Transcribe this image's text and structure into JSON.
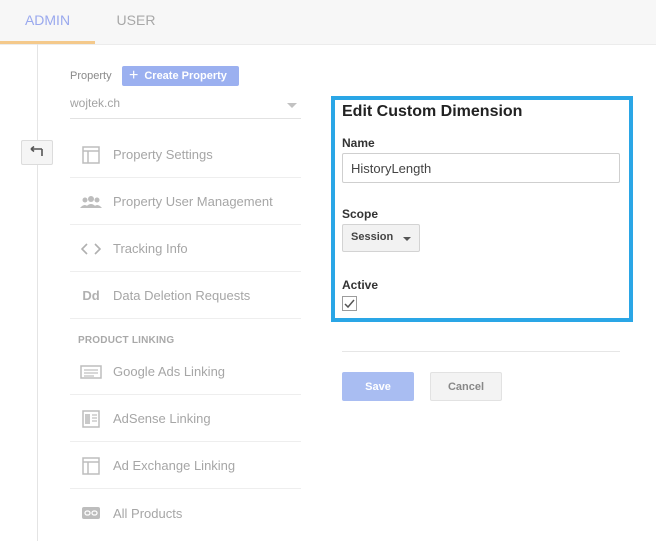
{
  "tabs": {
    "admin": "ADMIN",
    "user": "USER"
  },
  "property": {
    "label": "Property",
    "create_button": "Create Property",
    "selected": "wojtek.ch"
  },
  "nav": {
    "items": [
      {
        "label": "Property Settings",
        "icon": "layout-icon"
      },
      {
        "label": "Property User Management",
        "icon": "users-icon"
      },
      {
        "label": "Tracking Info",
        "icon": "code-icon"
      },
      {
        "label": "Data Deletion Requests",
        "icon": "dd-icon"
      }
    ],
    "section_label": "PRODUCT LINKING",
    "linking_items": [
      {
        "label": "Google Ads Linking",
        "icon": "ads-icon"
      },
      {
        "label": "AdSense Linking",
        "icon": "adsense-icon"
      },
      {
        "label": "Ad Exchange Linking",
        "icon": "adexchange-icon"
      },
      {
        "label": "All Products",
        "icon": "link-icon"
      }
    ]
  },
  "panel": {
    "title": "Edit Custom Dimension",
    "name_label": "Name",
    "name_value": "HistoryLength",
    "scope_label": "Scope",
    "scope_value": "Session",
    "active_label": "Active",
    "active_checked": true
  },
  "actions": {
    "save": "Save",
    "cancel": "Cancel"
  },
  "colors": {
    "accent": "#2aa6e6",
    "primary_button": "#a9bdf2",
    "tab_active": "#9aa9ee"
  }
}
